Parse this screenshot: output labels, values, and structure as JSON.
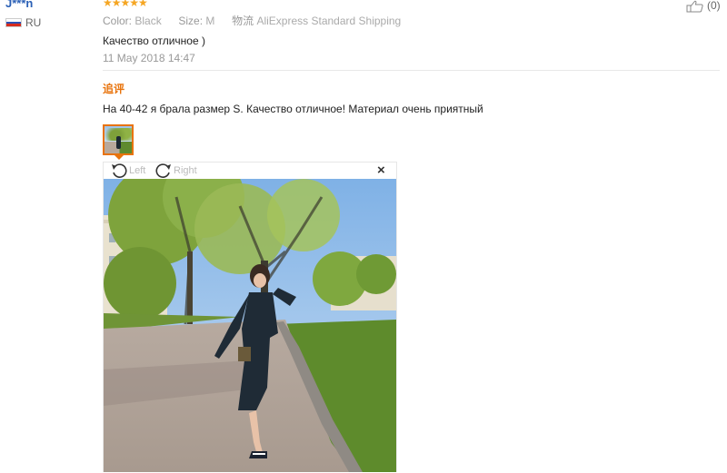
{
  "reviewer": {
    "name": "J***n",
    "country": "RU"
  },
  "rating": {
    "stars": 5,
    "stars_text": "★★★★★"
  },
  "helpful": {
    "count": "(0)",
    "icon": "thumbs-up-icon"
  },
  "meta": {
    "color_key": "Color:",
    "color_val": "Black",
    "size_key": "Size:",
    "size_val": "M",
    "shipping_key": "物流",
    "shipping_val": "AliExpress Standard Shipping"
  },
  "review": {
    "text": "Качество отличное )",
    "date": "11 May 2018 14:47"
  },
  "followup": {
    "label": "追评",
    "text": "На 40-42 я брала размер S. Качество отличное! Материал очень приятный"
  },
  "viewer": {
    "rotate_left": "Left",
    "rotate_right": "Right",
    "close": "×"
  },
  "colors": {
    "accent": "#e8730c",
    "link": "#2a5fb5",
    "stars": "#f5a623"
  }
}
